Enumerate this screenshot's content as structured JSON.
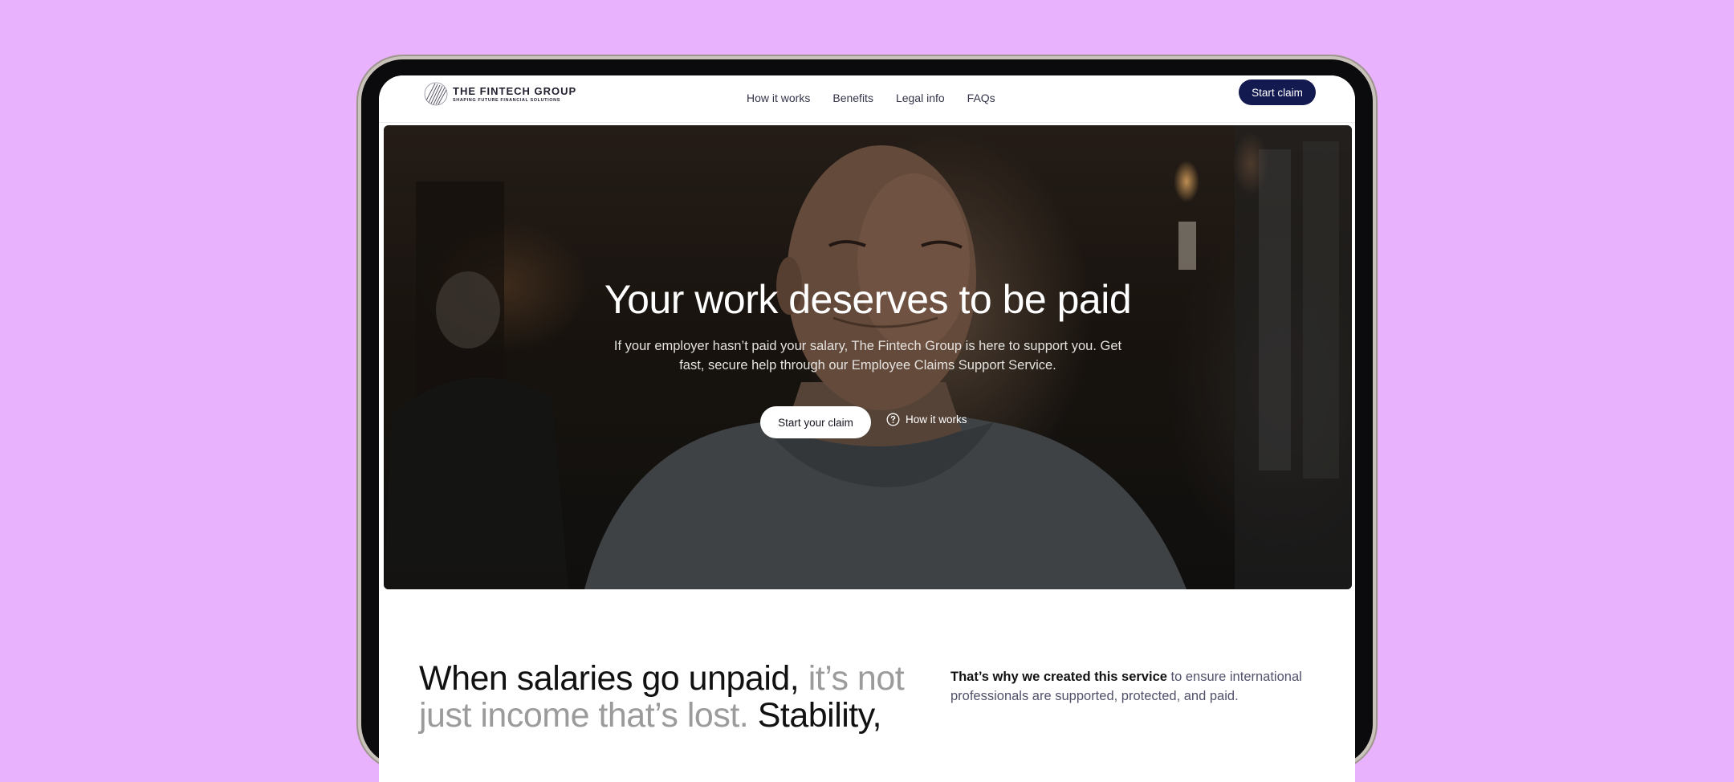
{
  "nav": {
    "logo_name": "THE FINTECH GROUP",
    "logo_tagline": "SHAPING FUTURE FINANCIAL SOLUTIONS",
    "links": [
      "How it works",
      "Benefits",
      "Legal info",
      "FAQs"
    ],
    "cta": "Start claim"
  },
  "hero": {
    "title": "Your work deserves to be paid",
    "subtitle": "If your employer hasn’t paid your salary, The Fintech Group is here to support you. Get fast, secure help through our Employee Claims Support Service.",
    "primary_cta": "Start your claim",
    "secondary_link": "How it works",
    "secondary_icon": "question-circle-icon"
  },
  "section": {
    "title_dark": "When salaries go unpaid,",
    "title_muted": "it’s not just income that’s lost.",
    "title_dark_2": "Stability,",
    "text_strong": "That’s why we created this service",
    "text_rest": "to ensure international professionals are supported, protected, and paid."
  },
  "colors": {
    "background": "#e8b2fc",
    "nav_cta": "#131a4f",
    "muted_text": "#9b9b9b"
  }
}
